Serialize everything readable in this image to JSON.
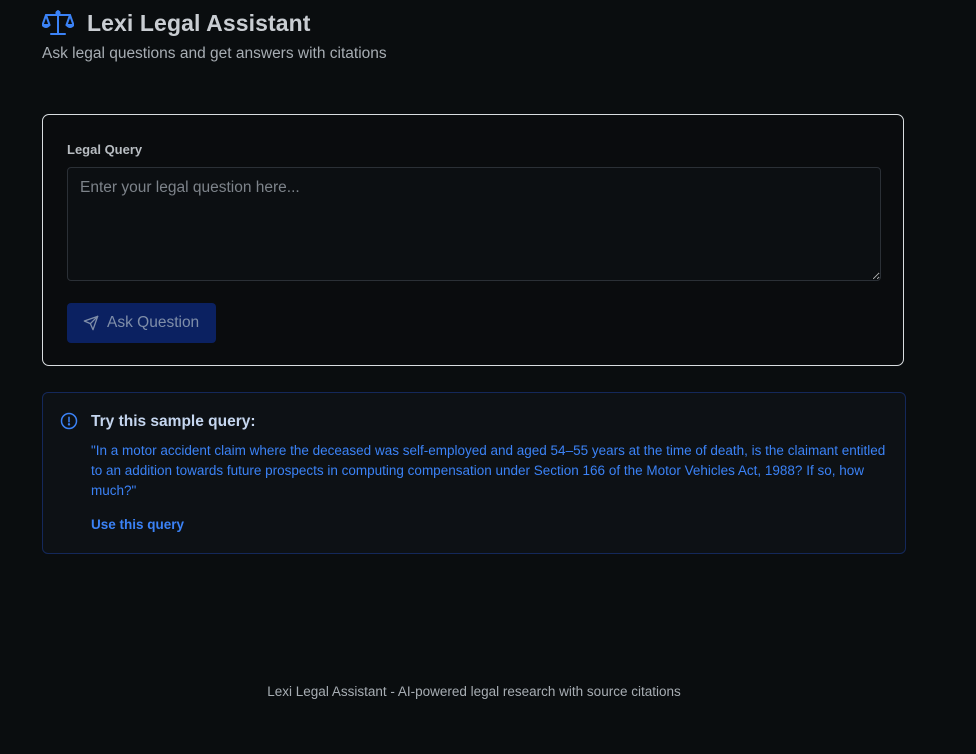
{
  "header": {
    "logo_icon": "scale-icon",
    "title": "Lexi Legal Assistant",
    "subtitle": "Ask legal questions and get answers with citations"
  },
  "query_form": {
    "label": "Legal Query",
    "textarea": {
      "value": "",
      "placeholder": "Enter your legal question here..."
    },
    "submit": {
      "icon": "send-icon",
      "label": "Ask Question"
    }
  },
  "sample": {
    "icon": "info-icon",
    "title": "Try this sample query:",
    "text": "\"In a motor accident claim where the deceased was self-employed and aged 54–55 years at the time of death, is the claimant entitled to an addition towards future prospects in computing compensation under Section 166 of the Motor Vehicles Act, 1988? If so, how much?\"",
    "link_label": "Use this query"
  },
  "footer": {
    "text": "Lexi Legal Assistant - AI-powered legal research with source citations"
  },
  "colors": {
    "background": "#0a0d0f",
    "accent": "#3b82f6",
    "button_bg": "#0b2161"
  }
}
